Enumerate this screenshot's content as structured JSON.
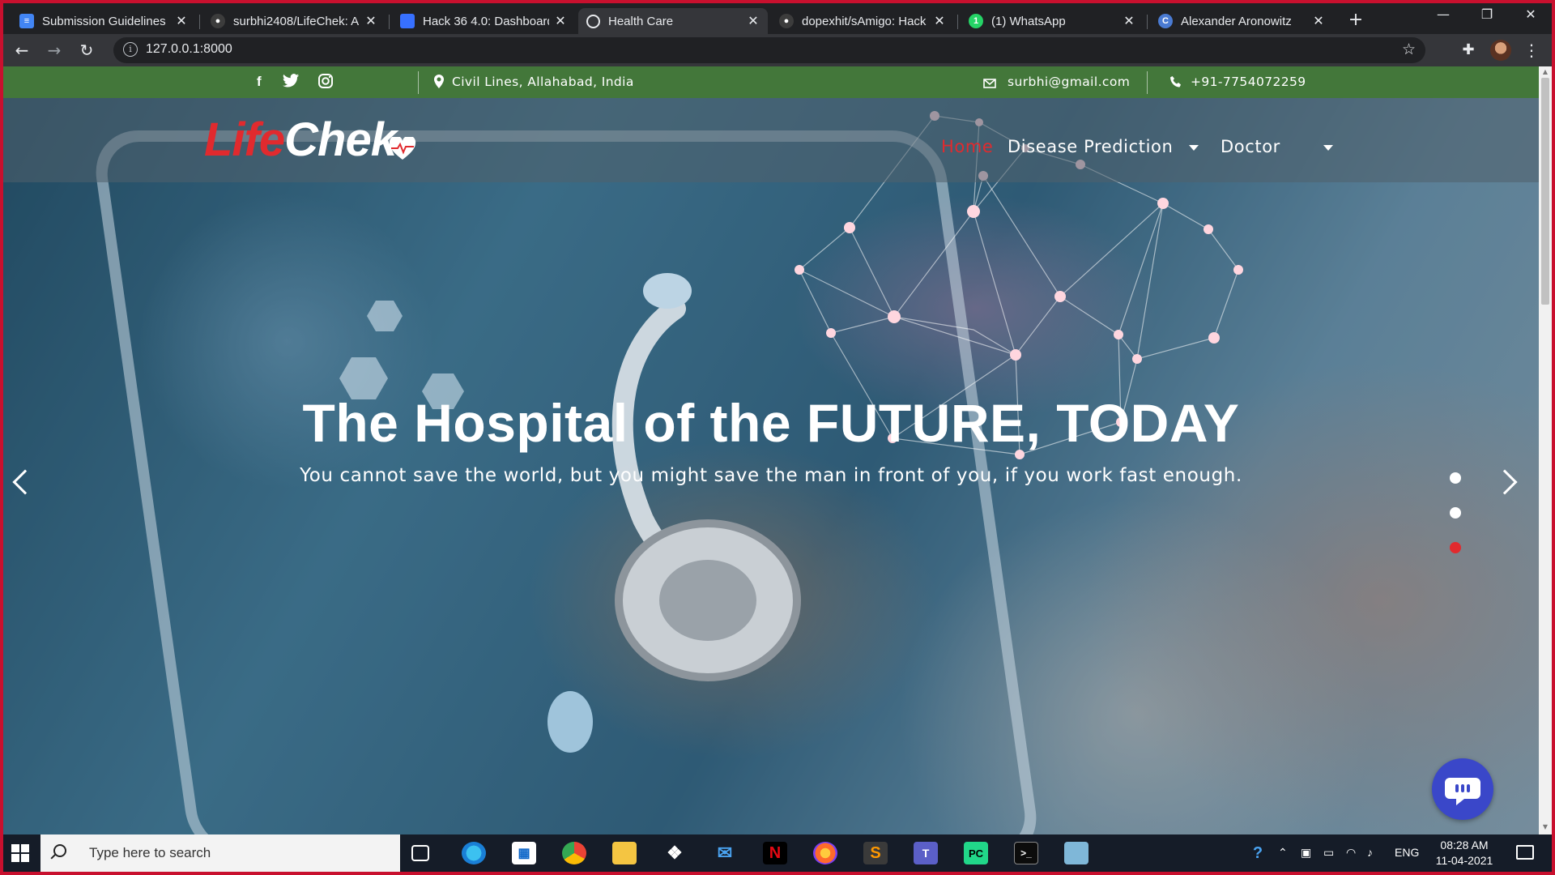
{
  "browser": {
    "tabs": [
      {
        "title": "Submission Guidelines",
        "icon": "docs-icon",
        "color": "#4285f4"
      },
      {
        "title": "surbhi2408/LifeChek: A",
        "icon": "github-icon",
        "color": "#202124"
      },
      {
        "title": "Hack 36 4.0: Dashboard",
        "icon": "devfolio-icon",
        "color": "#3770ff"
      },
      {
        "title": "Health Care",
        "icon": "globe-icon",
        "color": "#9aa0a6",
        "active": true
      },
      {
        "title": "dopexhit/sAmigo: Hack",
        "icon": "github-icon",
        "color": "#202124"
      },
      {
        "title": "(1) WhatsApp",
        "icon": "whatsapp-icon",
        "color": "#25d366"
      },
      {
        "title": "Alexander Aronowitz",
        "icon": "c-icon",
        "color": "#4a7bd3"
      }
    ],
    "url": "127.0.0.1:8000"
  },
  "site": {
    "topbar": {
      "location": "Civil Lines, Allahabad, India",
      "email": "surbhi@gmail.com",
      "phone": "+91-7754072259",
      "social": [
        "facebook-icon",
        "twitter-icon",
        "instagram-icon"
      ]
    },
    "logo": {
      "part1": "Life",
      "part2": "Chek"
    },
    "nav": {
      "home": "Home",
      "disease": "Disease Prediction",
      "doctor": "Doctor"
    },
    "hero": {
      "headline": "The Hospital of the FUTURE, TODAY",
      "subtext": "You cannot save the world, but you might save the man in front of you, if you work fast enough.",
      "slides": 3,
      "active_slide": 3
    },
    "colors": {
      "accent": "#e12a2e",
      "topbar": "#43773a",
      "chat": "#3a47c9"
    }
  },
  "taskbar": {
    "search_placeholder": "Type here to search",
    "lang": "ENG",
    "time": "08:28 AM",
    "date": "11-04-2021"
  }
}
